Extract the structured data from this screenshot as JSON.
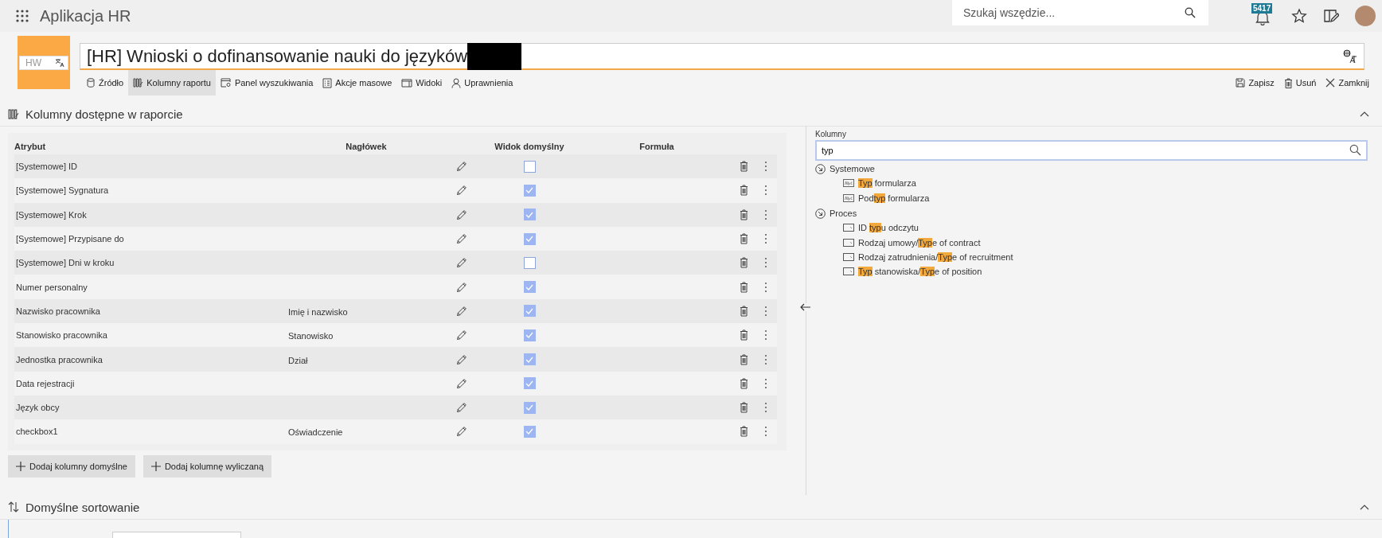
{
  "app": {
    "title": "Aplikacja HR"
  },
  "global_search": {
    "placeholder": "Szukaj wszędzie..."
  },
  "notifications": {
    "count": "5417"
  },
  "form": {
    "logo_text": "HW",
    "title": "[HR] Wnioski o dofinansowanie nauki do języków",
    "redacted": true
  },
  "toolbar": {
    "tabs": [
      {
        "kind": "source",
        "label": "Źródło",
        "selected": false
      },
      {
        "kind": "columns",
        "label": "Kolumny raportu",
        "selected": true
      },
      {
        "kind": "search-panel",
        "label": "Panel wyszukiwania",
        "selected": false
      },
      {
        "kind": "bulk",
        "label": "Akcje masowe",
        "selected": false
      },
      {
        "kind": "views",
        "label": "Widoki",
        "selected": false
      },
      {
        "kind": "permissions",
        "label": "Uprawnienia",
        "selected": false
      }
    ],
    "actions": [
      {
        "kind": "save",
        "label": "Zapisz"
      },
      {
        "kind": "delete",
        "label": "Usuń"
      },
      {
        "kind": "close",
        "label": "Zamknij"
      }
    ]
  },
  "columns_section": {
    "title": "Kolumny dostępne w raporcie"
  },
  "table": {
    "columns": [
      "Atrybut",
      "Nagłówek",
      "Widok domyślny",
      "Formuła"
    ],
    "rows": [
      {
        "attribute": "[Systemowe] ID",
        "default_view": false
      },
      {
        "attribute": "[Systemowe] Sygnatura",
        "default_view": true
      },
      {
        "attribute": "[Systemowe] Krok",
        "default_view": true
      },
      {
        "attribute": "[Systemowe] Przypisane do",
        "default_view": true
      },
      {
        "attribute": "[Systemowe] Dni w kroku",
        "default_view": false
      },
      {
        "attribute": "Numer personalny",
        "default_view": true
      },
      {
        "attribute": "Nazwisko pracownika",
        "header": "Imię i nazwisko",
        "default_view": true
      },
      {
        "attribute": "Stanowisko pracownika",
        "header": "Stanowisko",
        "default_view": true
      },
      {
        "attribute": "Jednostka pracownika",
        "header": "Dział",
        "default_view": true
      },
      {
        "attribute": "Data rejestracji",
        "default_view": true
      },
      {
        "attribute": "Język obcy",
        "default_view": true
      },
      {
        "attribute": "checkbox1",
        "header": "Oświadczenie",
        "default_view": true
      }
    ]
  },
  "buttons": [
    "Dodaj kolumny domyślne",
    "Dodaj kolumnę wyliczaną"
  ],
  "columns_panel": {
    "label": "Kolumny",
    "search": {
      "value": "typ"
    },
    "groups": [
      {
        "name": "Systemowe",
        "expanded": true,
        "items": [
          {
            "kind": "text",
            "segments": [
              {
                "text": "Typ",
                "match": true
              },
              {
                "text": " formularza",
                "match": false
              }
            ]
          },
          {
            "kind": "text",
            "segments": [
              {
                "text": "Pod",
                "match": false
              },
              {
                "text": "typ",
                "match": true
              },
              {
                "text": " formularza",
                "match": false
              }
            ]
          }
        ]
      },
      {
        "name": "Proces",
        "expanded": true,
        "items": [
          {
            "kind": "field",
            "segments": [
              {
                "text": "ID ",
                "match": false
              },
              {
                "text": "typ",
                "match": true
              },
              {
                "text": "u odczytu",
                "match": false
              }
            ]
          },
          {
            "kind": "field",
            "segments": [
              {
                "text": "Rodzaj umowy/",
                "match": false
              },
              {
                "text": "Typ",
                "match": true
              },
              {
                "text": "e of contract",
                "match": false
              }
            ]
          },
          {
            "kind": "field",
            "segments": [
              {
                "text": "Rodzaj zatrudnienia/",
                "match": false
              },
              {
                "text": "Typ",
                "match": true
              },
              {
                "text": "e of recruitment",
                "match": false
              }
            ]
          },
          {
            "kind": "field",
            "segments": [
              {
                "text": "Typ",
                "match": true
              },
              {
                "text": " stanowiska/",
                "match": false
              },
              {
                "text": "Typ",
                "match": true
              },
              {
                "text": "e of position",
                "match": false
              }
            ]
          }
        ]
      }
    ]
  },
  "sort_section": {
    "title": "Domyślne sortowanie"
  }
}
